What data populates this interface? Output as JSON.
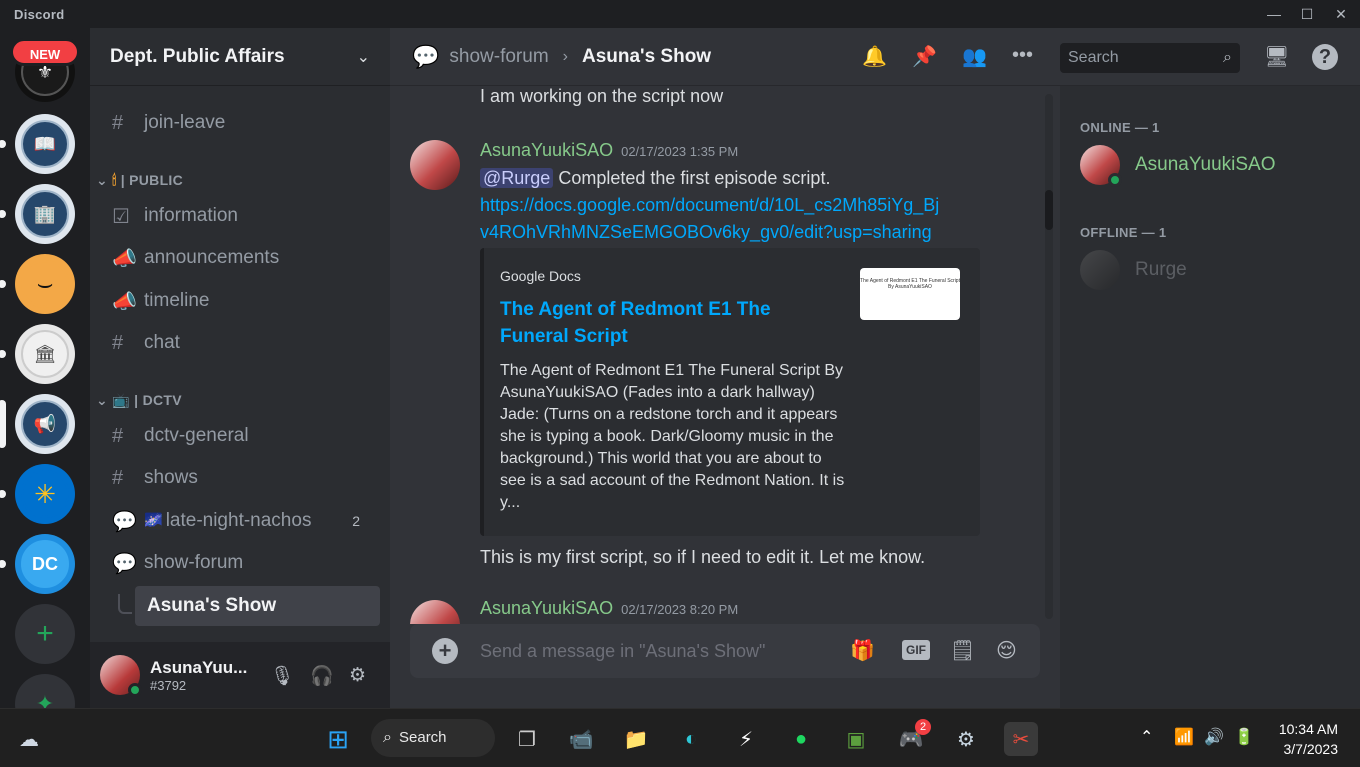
{
  "window": {
    "brand": "Discord",
    "minimize": "—",
    "maximize": "☐",
    "close": "✕"
  },
  "rail": {
    "new_badge": "NEW",
    "add_server": "+",
    "explore": "✦"
  },
  "guild": {
    "name": "Dept. Public Affairs",
    "chevron": "⌄"
  },
  "categories": {
    "public": "| PUBLIC",
    "dctv": "| DCTV"
  },
  "channels": {
    "join_leave": "join-leave",
    "information": "information",
    "announcements": "announcements",
    "timeline": "timeline",
    "chat": "chat",
    "dctv_general": "dctv-general",
    "shows": "shows",
    "late_night_nachos": "late-night-nachos",
    "late_night_nachos_count": "2",
    "show_forum": "show-forum",
    "asunas_show": "Asuna's Show"
  },
  "user": {
    "name": "AsunaYuu...",
    "tag": "#3792"
  },
  "header": {
    "forum": "show-forum",
    "separator": "›",
    "thread": "Asuna's Show",
    "search_placeholder": "Search"
  },
  "messages": {
    "prev_line": "I am working on the script now",
    "m1": {
      "author": "AsunaYuukiSAO",
      "timestamp": "02/17/2023 1:35 PM",
      "mention": "@Rurge",
      "text": " Completed the first episode script.",
      "link_line1": "https://docs.google.com/document/d/10L_cs2Mh85iYg_Bj",
      "link_line2": "v4ROhVRhMNZSeEMGOBOv6ky_gv0/edit?usp=sharing",
      "embed": {
        "provider": "Google Docs",
        "title": "The Agent of Redmont E1 The Funeral Script",
        "description": "The Agent of Redmont E1 The Funeral Script By AsunaYuukiSAO (Fades into a dark hallway) Jade: (Turns on a redstone torch and it appears she is typing a book. Dark/Gloomy music in the background.) This world that you are about to see is a sad account of the Redmont Nation. It is y...",
        "thumb_line1": "The Agent of Redmont E1 The Funeral Script",
        "thumb_line2": "By AsunaYuukiSAO"
      },
      "followup": "This is my first script, so if I need to edit it. Let me know."
    },
    "m2": {
      "author": "AsunaYuukiSAO",
      "timestamp": "02/17/2023 8:20 PM"
    }
  },
  "composer": {
    "placeholder": "Send a message in \"Asuna's Show\"",
    "gif": "GIF"
  },
  "members": {
    "online_header": "ONLINE — 1",
    "online": [
      {
        "name": "AsunaYuukiSAO",
        "color": "#86c98a"
      }
    ],
    "offline_header": "OFFLINE — 1",
    "offline": [
      {
        "name": "Rurge"
      }
    ]
  },
  "taskbar": {
    "search": "Search",
    "time": "10:34 AM",
    "date": "3/7/2023",
    "discord_badge": "2"
  },
  "colors": {
    "accent_link": "#00a8fc",
    "online_name": "#86c98a",
    "online_status": "#23a55a",
    "badge_red": "#f23f43"
  }
}
